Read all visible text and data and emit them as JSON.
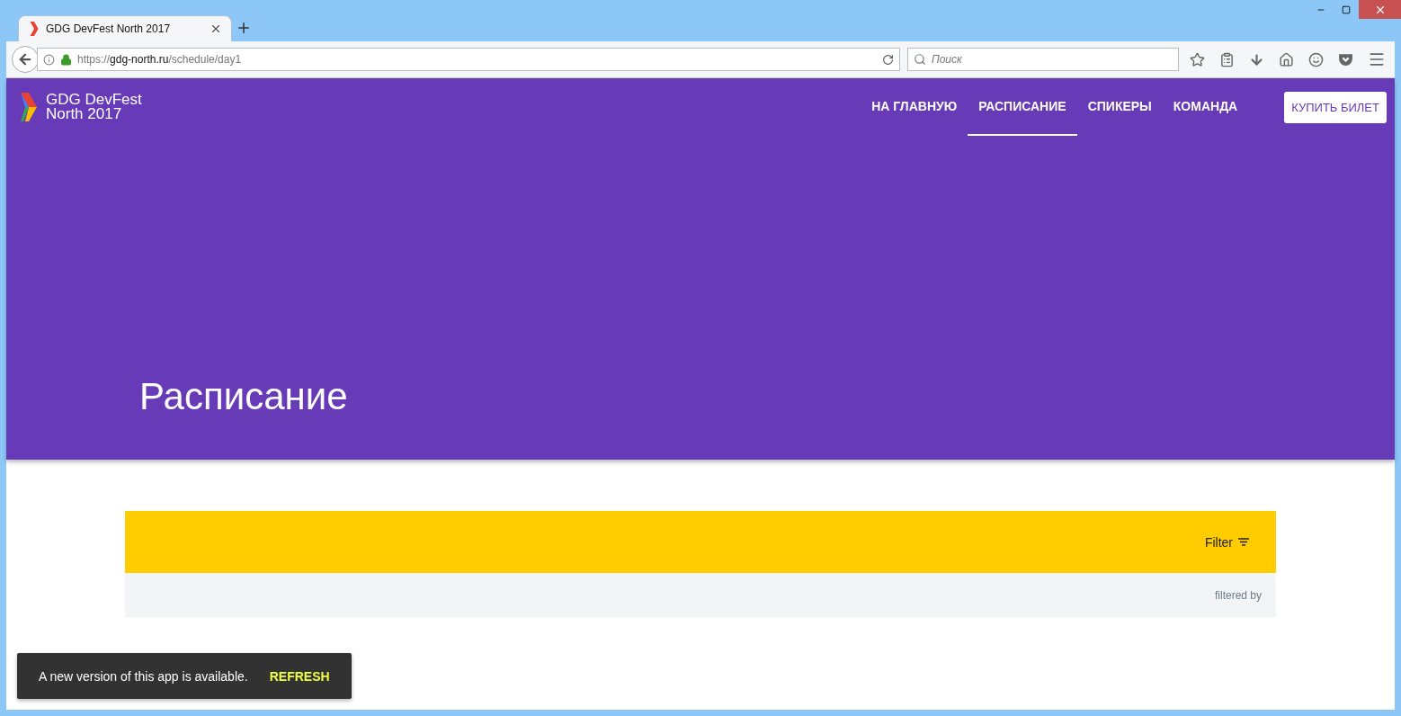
{
  "browser": {
    "tab": {
      "title": "GDG DevFest North 2017",
      "selected": true
    },
    "url": {
      "scheme": "https://",
      "host": "gdg-north.ru",
      "path": "/schedule/day1"
    },
    "search": {
      "placeholder": "Поиск"
    }
  },
  "site": {
    "logo_text": [
      "GDG DevFest",
      "North 2017"
    ],
    "nav": [
      {
        "label": "НА ГЛАВНУЮ",
        "selected": false
      },
      {
        "label": "РАСПИСАНИЕ",
        "selected": true
      },
      {
        "label": "СПИКЕРЫ",
        "selected": false
      },
      {
        "label": "КОМАНДА",
        "selected": false
      }
    ],
    "cta": "КУПИТЬ БИЛЕТ",
    "hero_title": "Расписание"
  },
  "schedule": {
    "filter_label": "Filter",
    "filtered_by": "filtered by"
  },
  "snackbar": {
    "message": "A new version of this app is available.",
    "action": "REFRESH"
  }
}
